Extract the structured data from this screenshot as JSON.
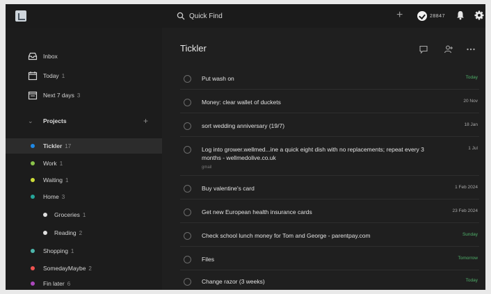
{
  "topbar": {
    "search_label": "Quick Find",
    "karma_value": "28847"
  },
  "sidebar": {
    "nav": [
      {
        "label": "Inbox",
        "count": ""
      },
      {
        "label": "Today",
        "count": "1"
      },
      {
        "label": "Next 7 days",
        "count": "3"
      }
    ],
    "projects_label": "Projects",
    "projects": [
      {
        "label": "Tickler",
        "count": "17",
        "color": "#1e88e5"
      },
      {
        "label": "Work",
        "count": "1",
        "color": "#8bc34a"
      },
      {
        "label": "Waiting",
        "count": "1",
        "color": "#cddc39"
      },
      {
        "label": "Home",
        "count": "3",
        "color": "#26a69a"
      },
      {
        "label": "Groceries",
        "count": "1",
        "color": "#e0e0e0"
      },
      {
        "label": "Reading",
        "count": "2",
        "color": "#e0e0e0"
      },
      {
        "label": "Shopping",
        "count": "1",
        "color": "#4db6ac"
      },
      {
        "label": "SomedayMaybe",
        "count": "2",
        "color": "#ef5350"
      },
      {
        "label": "Fin later",
        "count": "6",
        "color": "#ab47bc"
      }
    ]
  },
  "main": {
    "title": "Tickler",
    "tasks": [
      {
        "title": "Put wash on",
        "sub": "",
        "due": "Today",
        "due_color": "green"
      },
      {
        "title": "Money: clear wallet of duckets",
        "sub": "",
        "due": "20 Nov",
        "due_color": "gray"
      },
      {
        "title": "sort wedding anniversary (19/7)",
        "sub": "",
        "due": "18 Jan",
        "due_color": "gray"
      },
      {
        "title": "Log into grower.wellmed...ine a quick eight dish with no replacements; repeat every 3 months - wellmedolive.co.uk",
        "sub": "gmail",
        "due": "1 Jul",
        "due_color": "gray"
      },
      {
        "title": "Buy valentine's card",
        "sub": "",
        "due": "1 Feb 2024",
        "due_color": "gray"
      },
      {
        "title": "Get new European health insurance cards",
        "sub": "",
        "due": "23 Feb 2024",
        "due_color": "gray"
      },
      {
        "title": "Check school lunch money for Tom and George - parentpay.com",
        "sub": "",
        "due": "Sunday",
        "due_color": "green"
      },
      {
        "title": "Files",
        "sub": "",
        "due": "Tomorrow",
        "due_color": "green"
      },
      {
        "title": "Change razor (3 weeks)",
        "sub": "",
        "due": "Today",
        "due_color": "green"
      }
    ]
  }
}
